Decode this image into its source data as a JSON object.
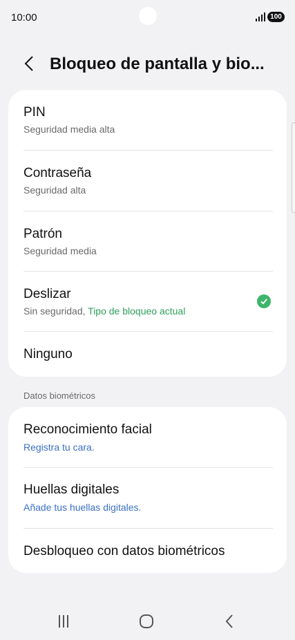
{
  "status_bar": {
    "time": "10:00",
    "battery": "100",
    "signal_icon": "signal-bars-icon"
  },
  "header": {
    "title": "Bloqueo de pantalla y bio...",
    "back_icon": "chevron-left-icon"
  },
  "lock_types": [
    {
      "title": "PIN",
      "subtitle": "Seguridad media alta"
    },
    {
      "title": "Contraseña",
      "subtitle": "Seguridad alta"
    },
    {
      "title": "Patrón",
      "subtitle": "Seguridad media"
    },
    {
      "title": "Deslizar",
      "subtitle": "Sin seguridad,",
      "subtitle_highlight": "Tipo de bloqueo actual",
      "selected": true
    },
    {
      "title": "Ninguno"
    }
  ],
  "biometrics": {
    "section_label": "Datos biométricos",
    "items": [
      {
        "title": "Reconocimiento facial",
        "subtitle": "Registra tu cara."
      },
      {
        "title": "Huellas digitales",
        "subtitle": "Añade tus huellas digitales."
      },
      {
        "title": "Desbloqueo con datos biométricos"
      }
    ]
  },
  "colors": {
    "background": "#f2f2f4",
    "card": "#ffffff",
    "link_blue": "#3b6fc4",
    "selected_green": "#3db56b"
  },
  "nav_bar": {
    "recents_icon": "recents-icon",
    "home_icon": "home-icon",
    "back_icon": "back-icon"
  }
}
